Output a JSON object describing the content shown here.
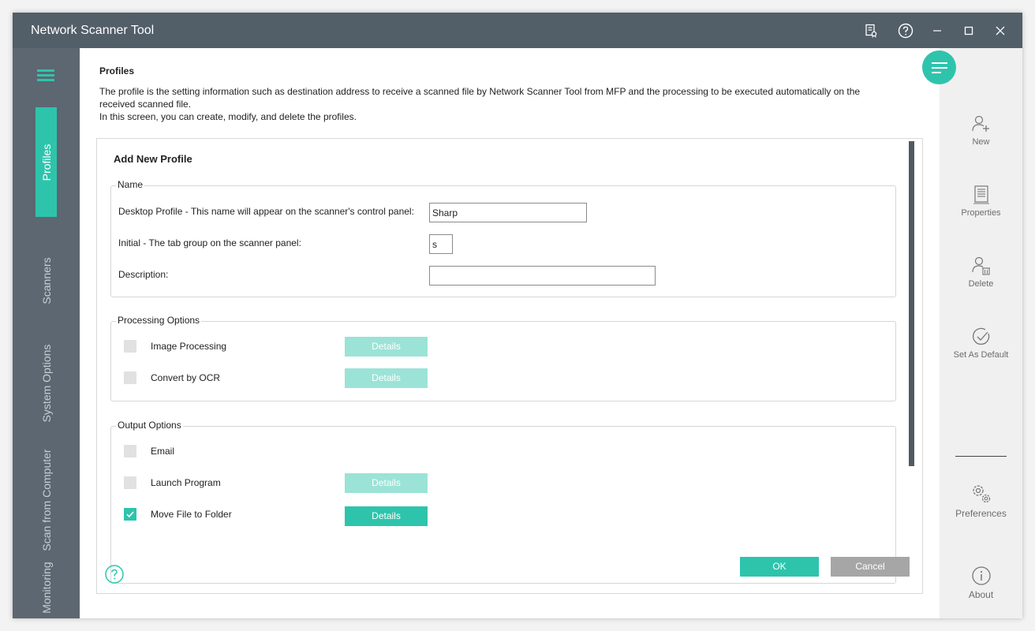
{
  "app": {
    "title": "Network Scanner Tool"
  },
  "titlebar": {
    "icons": [
      "license-icon",
      "help-icon",
      "minimize-icon",
      "maximize-icon",
      "close-icon"
    ]
  },
  "leftnav": {
    "items": [
      {
        "label": "Profiles",
        "active": true
      },
      {
        "label": "Scanners",
        "active": false
      },
      {
        "label": "System Options",
        "active": false
      },
      {
        "label": "Scan from Computer",
        "active": false
      },
      {
        "label": "Monitoring",
        "active": false
      }
    ]
  },
  "page": {
    "title": "Profiles",
    "desc1": "The profile is the setting information such as destination address to receive a scanned file by Network Scanner Tool from MFP and the processing to be executed automatically on the received scanned file.",
    "desc2": "In this screen, you can create, modify, and delete the profiles."
  },
  "form": {
    "title": "Add New Profile",
    "name_group": {
      "legend": "Name",
      "desktop_profile_label": "Desktop Profile - This name will appear on the scanner's control panel:",
      "desktop_profile_value": "Sharp",
      "initial_label": "Initial - The tab group on the scanner panel:",
      "initial_value": "s",
      "description_label": "Description:",
      "description_value": ""
    },
    "processing_group": {
      "legend": "Processing Options",
      "options": [
        {
          "label": "Image Processing",
          "checked": false,
          "details": "Details"
        },
        {
          "label": "Convert by OCR",
          "checked": false,
          "details": "Details"
        }
      ]
    },
    "output_group": {
      "legend": "Output Options",
      "options": [
        {
          "label": "Email",
          "checked": false
        },
        {
          "label": "Launch Program",
          "checked": false,
          "details": "Details"
        },
        {
          "label": "Move File to Folder",
          "checked": true,
          "details": "Details"
        }
      ]
    },
    "ok_label": "OK",
    "cancel_label": "Cancel"
  },
  "rightbar": {
    "new": "New",
    "properties": "Properties",
    "delete": "Delete",
    "set_default": "Set As Default",
    "preferences": "Preferences",
    "about": "About"
  },
  "colors": {
    "accent": "#2ec4ac",
    "accent_disabled": "#9be3d6",
    "titlebar": "#525e68",
    "sidebar": "#5c6771"
  }
}
